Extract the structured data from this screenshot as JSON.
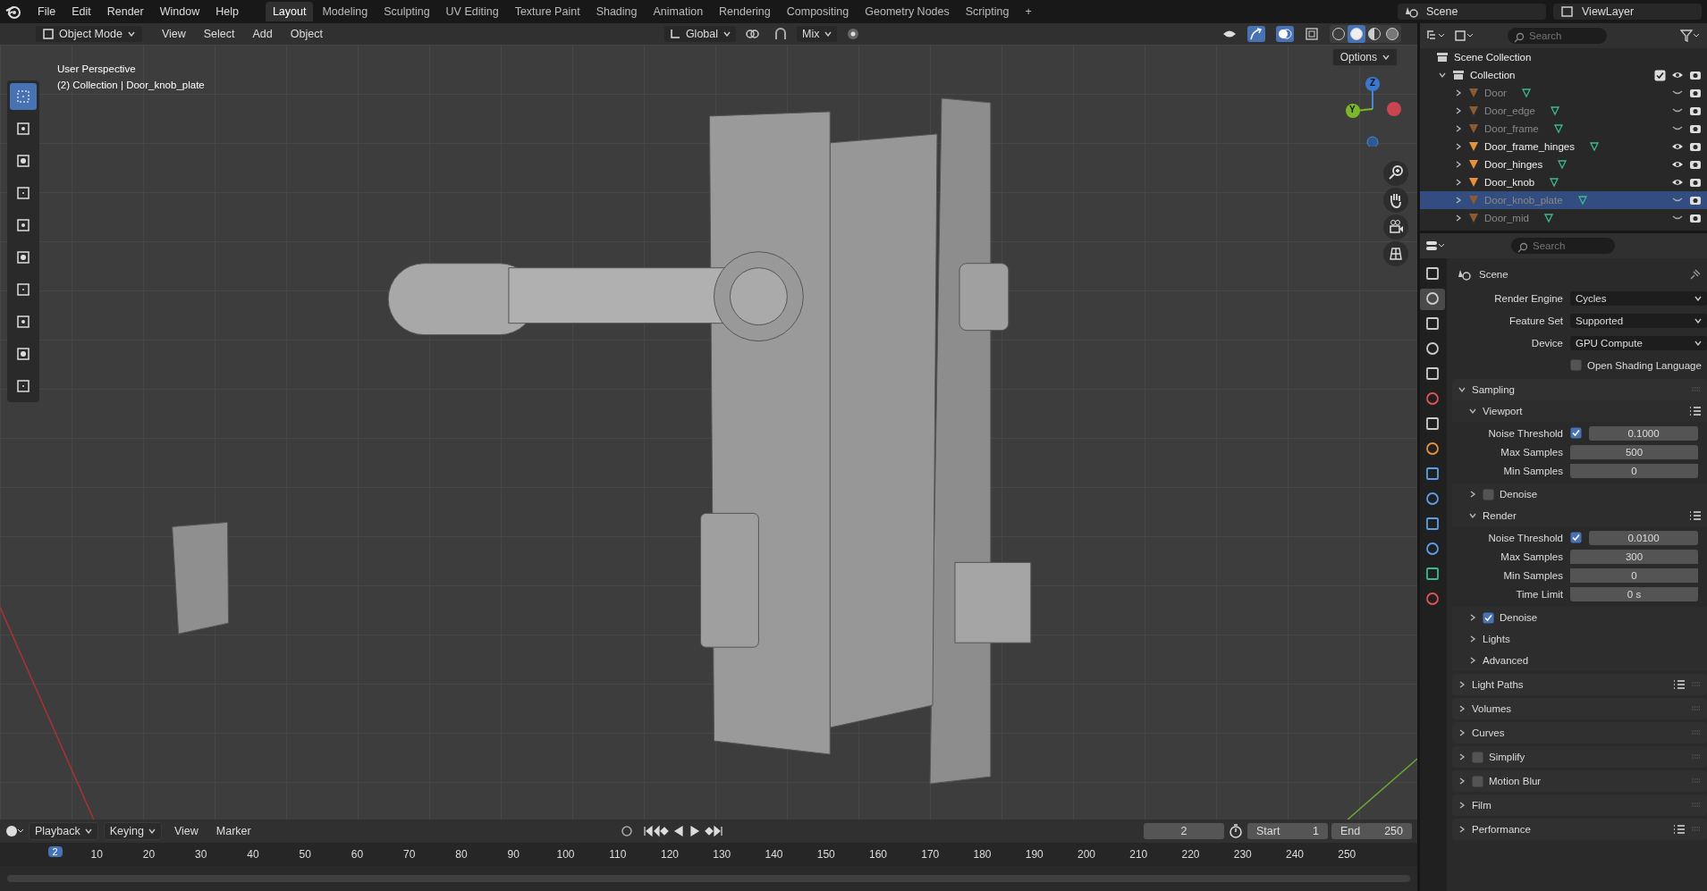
{
  "menu": [
    "File",
    "Edit",
    "Render",
    "Window",
    "Help"
  ],
  "workspaces": [
    {
      "label": "Layout",
      "selected": true
    },
    {
      "label": "Modeling",
      "selected": false
    },
    {
      "label": "Sculpting",
      "selected": false
    },
    {
      "label": "UV Editing",
      "selected": false
    },
    {
      "label": "Texture Paint",
      "selected": false
    },
    {
      "label": "Shading",
      "selected": false
    },
    {
      "label": "Animation",
      "selected": false
    },
    {
      "label": "Rendering",
      "selected": false
    },
    {
      "label": "Compositing",
      "selected": false
    },
    {
      "label": "Geometry Nodes",
      "selected": false
    },
    {
      "label": "Scripting",
      "selected": false
    },
    {
      "label": "+",
      "selected": false
    }
  ],
  "scene": "Scene",
  "view_layer": "ViewLayer",
  "viewport": {
    "mode": "Object Mode",
    "menus": [
      "View",
      "Select",
      "Add",
      "Object"
    ],
    "orientation": "Global",
    "snap_target": "Mix",
    "options": "Options",
    "overlay_lines": [
      "User Perspective",
      "(2) Collection | Door_knob_plate"
    ],
    "axis_labels": [
      "Z",
      "Y"
    ],
    "tools": [
      {
        "selected": true
      },
      {
        "selected": false
      },
      {
        "selected": false
      },
      {
        "selected": false
      },
      {
        "selected": false
      },
      {
        "selected": false
      },
      {
        "selected": false
      },
      {
        "selected": false
      },
      {
        "selected": false
      },
      {
        "selected": false
      }
    ],
    "shading": [
      {
        "selected": false
      },
      {
        "selected": true
      },
      {
        "selected": false
      },
      {
        "selected": false
      }
    ]
  },
  "outliner": {
    "search_placeholder": "Search",
    "root": "Scene Collection",
    "collection": {
      "label": "Collection",
      "expanded": true,
      "checked": true,
      "children": [
        {
          "name": "Door",
          "visible": false,
          "selected": false
        },
        {
          "name": "Door_edge",
          "visible": false,
          "selected": false
        },
        {
          "name": "Door_frame",
          "visible": false,
          "selected": false
        },
        {
          "name": "Door_frame_hinges",
          "visible": true,
          "selected": false
        },
        {
          "name": "Door_hinges",
          "visible": true,
          "selected": false
        },
        {
          "name": "Door_knob",
          "visible": true,
          "selected": false
        },
        {
          "name": "Door_knob_plate",
          "visible": false,
          "selected": true
        },
        {
          "name": "Door_mid",
          "visible": false,
          "selected": false
        }
      ]
    }
  },
  "properties": {
    "search_placeholder": "Search",
    "context": "Scene",
    "tabs": [
      {
        "selected": false
      },
      {
        "selected": true
      },
      {
        "selected": false
      },
      {
        "selected": false
      },
      {
        "selected": false
      },
      {
        "selected": false
      },
      {
        "selected": false
      },
      {
        "selected": false
      },
      {
        "selected": false
      },
      {
        "selected": false
      },
      {
        "selected": false
      },
      {
        "selected": false
      },
      {
        "selected": false
      },
      {
        "selected": false
      }
    ],
    "fields": [
      {
        "label": "Render Engine",
        "value": "Cycles"
      },
      {
        "label": "Feature Set",
        "value": "Supported"
      },
      {
        "label": "Device",
        "value": "GPU Compute"
      }
    ],
    "osl": {
      "label": "Open Shading Language",
      "checked": false
    },
    "panels": [
      {
        "label": "Sampling",
        "expanded": true,
        "presets_menu": false,
        "subpanels": [
          {
            "label": "Viewport",
            "expanded": true,
            "presets_menu": true,
            "rows": [
              {
                "kind": "toggle_value",
                "label": "Noise Threshold",
                "checked": true,
                "value": "0.1000"
              },
              {
                "kind": "value",
                "label": "Max Samples",
                "value": "500"
              },
              {
                "kind": "value",
                "label": "Min Samples",
                "value": "0"
              }
            ]
          },
          {
            "label": "Denoise",
            "expanded": false,
            "presets_menu": false,
            "checked": false
          },
          {
            "label": "Render",
            "expanded": true,
            "presets_menu": true,
            "rows": [
              {
                "kind": "toggle_value",
                "label": "Noise Threshold",
                "checked": true,
                "value": "0.0100"
              },
              {
                "kind": "value",
                "label": "Max Samples",
                "value": "300"
              },
              {
                "kind": "value",
                "label": "Min Samples",
                "value": "0"
              },
              {
                "kind": "value",
                "label": "Time Limit",
                "value": "0 s"
              }
            ]
          },
          {
            "label": "Denoise",
            "expanded": false,
            "presets_menu": false,
            "checked": true
          },
          {
            "label": "Lights",
            "expanded": false,
            "presets_menu": false
          },
          {
            "label": "Advanced",
            "expanded": false,
            "presets_menu": false
          }
        ]
      },
      {
        "label": "Light Paths",
        "expanded": false,
        "presets_menu": true
      },
      {
        "label": "Volumes",
        "expanded": false,
        "presets_menu": false
      },
      {
        "label": "Curves",
        "expanded": false,
        "presets_menu": false
      },
      {
        "label": "Simplify",
        "expanded": false,
        "presets_menu": false,
        "checked": false
      },
      {
        "label": "Motion Blur",
        "expanded": false,
        "presets_menu": false,
        "checked": false
      },
      {
        "label": "Film",
        "expanded": false,
        "presets_menu": false
      },
      {
        "label": "Performance",
        "expanded": false,
        "presets_menu": true
      }
    ]
  },
  "timeline": {
    "menus": [
      "Playback",
      "Keying",
      "View",
      "Marker"
    ],
    "current_frame": "2",
    "start_label": "Start",
    "start": "1",
    "end_label": "End",
    "end": "250",
    "marker": "2",
    "ticks": [
      "10",
      "20",
      "30",
      "40",
      "50",
      "60",
      "70",
      "80",
      "90",
      "100",
      "110",
      "120",
      "130",
      "140",
      "150",
      "160",
      "170",
      "180",
      "190",
      "200",
      "210",
      "220",
      "230",
      "240",
      "250"
    ]
  }
}
